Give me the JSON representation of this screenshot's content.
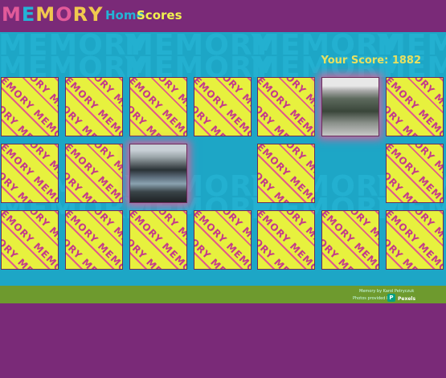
{
  "header": {
    "logo_letters": [
      "M",
      "E",
      "M",
      "O",
      "R",
      "Y"
    ],
    "logo_colors": [
      "#e25a9a",
      "#23b4d6",
      "#f0c84e",
      "#e25a9a",
      "#f0c84e",
      "#f0c84e"
    ],
    "nav": {
      "home": "Home",
      "scores": "Scores"
    }
  },
  "background_word": "MEMORY",
  "score": {
    "label": "Your Score:",
    "value": "1882"
  },
  "cards": [
    {
      "row": 0,
      "col": 0,
      "state": "back"
    },
    {
      "row": 0,
      "col": 1,
      "state": "back"
    },
    {
      "row": 0,
      "col": 2,
      "state": "back"
    },
    {
      "row": 0,
      "col": 3,
      "state": "back"
    },
    {
      "row": 0,
      "col": 4,
      "state": "back"
    },
    {
      "row": 0,
      "col": 5,
      "state": "face",
      "image": "mountain-forest-photo"
    },
    {
      "row": 0,
      "col": 6,
      "state": "back"
    },
    {
      "row": 1,
      "col": 0,
      "state": "back"
    },
    {
      "row": 1,
      "col": 1,
      "state": "back"
    },
    {
      "row": 1,
      "col": 2,
      "state": "face",
      "image": "mountain-lake-photo"
    },
    {
      "row": 1,
      "col": 3,
      "state": "empty"
    },
    {
      "row": 1,
      "col": 4,
      "state": "back"
    },
    {
      "row": 1,
      "col": 5,
      "state": "empty"
    },
    {
      "row": 1,
      "col": 6,
      "state": "back"
    },
    {
      "row": 2,
      "col": 0,
      "state": "back"
    },
    {
      "row": 2,
      "col": 1,
      "state": "back"
    },
    {
      "row": 2,
      "col": 2,
      "state": "back"
    },
    {
      "row": 2,
      "col": 3,
      "state": "back"
    },
    {
      "row": 2,
      "col": 4,
      "state": "back"
    },
    {
      "row": 2,
      "col": 5,
      "state": "back"
    },
    {
      "row": 2,
      "col": 6,
      "state": "back"
    }
  ],
  "card_back_text": "MEMORY",
  "footer": {
    "credit": "Memory by Karol Petryczuk",
    "photos": "Photos provided by",
    "provider": "Pexels"
  },
  "colors": {
    "purple": "#7a2a78",
    "teal": "#1da6c6",
    "yellow": "#e7f13e",
    "pink": "#e15a8a",
    "green": "#6e9a2e"
  }
}
